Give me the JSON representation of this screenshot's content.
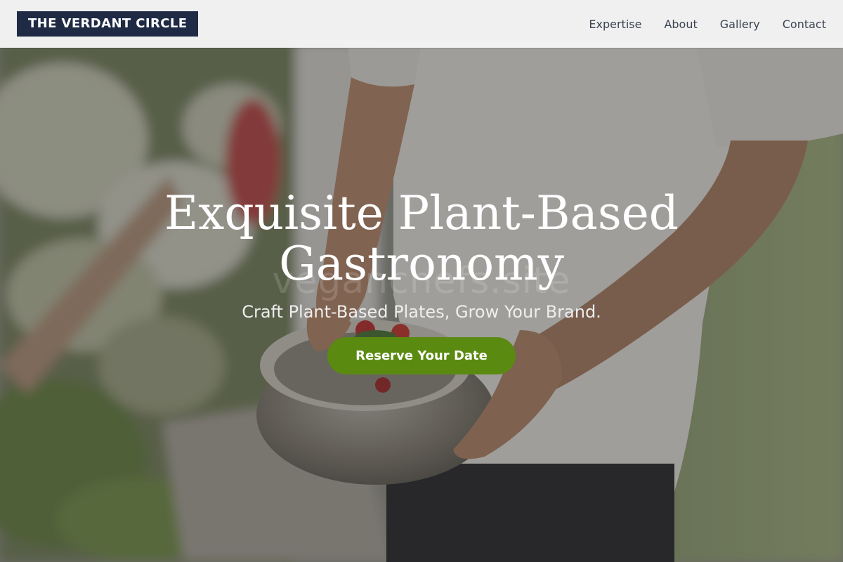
{
  "header": {
    "logo_text": "THE VERDANT CIRCLE",
    "nav": [
      "Expertise",
      "About",
      "Gallery",
      "Contact"
    ]
  },
  "hero": {
    "title_line1": "Exquisite Plant-Based",
    "title_line2": "Gastronomy",
    "watermark": "veganchefs.site",
    "subtitle": "Craft Plant-Based Plates, Grow Your Brand.",
    "cta_label": "Reserve Your Date"
  },
  "colors": {
    "logo_bg": "#1f2a44",
    "cta_bg": "#5a8a10",
    "nav_bg": "#f6f6f6",
    "overlay": "#3a3a3a"
  }
}
